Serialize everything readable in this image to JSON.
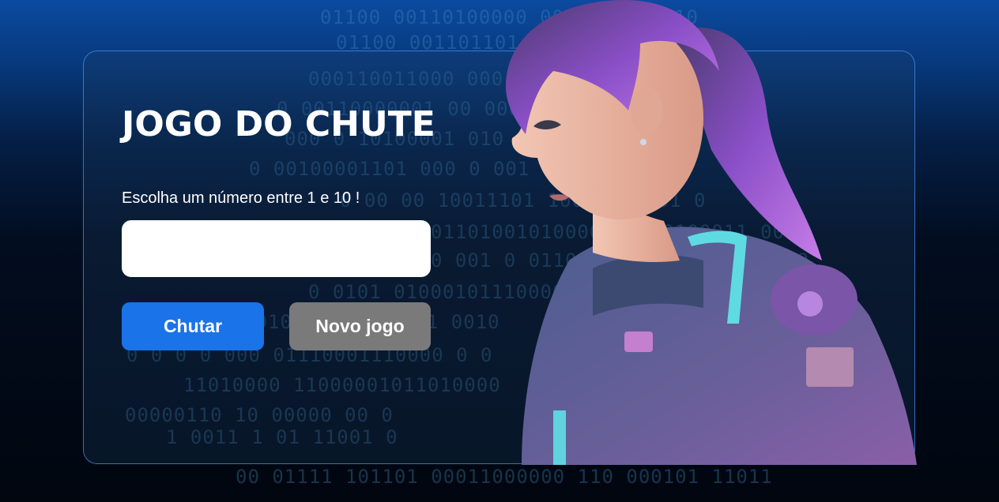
{
  "game": {
    "title": "JOGO DO CHUTE",
    "prompt": "Escolha um número entre 1 e 10 !",
    "input_value": "",
    "input_placeholder": "",
    "guess_button_label": "Chutar",
    "new_game_button_label": "Novo jogo"
  },
  "binary_lines": [
    "01100 00110100000        0001000000 10",
    "01100 001101101              011 1 0",
    "000110011000 000        0001101000010",
    "0  00110000001 00    0000011  0  0",
    "000 0  10100001 010         001011",
    "0  00100001101 000         0  001 0 0",
    "0 00 00 10011101 10001   11101  0",
    "01101001010000 000    0100011 00",
    "0 001 0 01100000110 1000000  0 0",
    "0 0101 010001011100000    000 01",
    "0 1 0 0 010 00001100001    0010",
    "0 0  0  0 000 01110001110000 0 0",
    "11010000 11000001011010000",
    "00000110  10  00000  00 0",
    "1  0011  1  01  11001 0",
    "00 01111  101101 00011000000 110 000101 11011"
  ],
  "illustration": {
    "description_icon": "astronaut-girl-illustration",
    "colors": {
      "hair": "#8a4fc7",
      "suit": "#5a6a9a",
      "glow": "#5ff0f0"
    }
  },
  "colors": {
    "primary_button": "#1a73e8",
    "secondary_button": "#7a7a7a",
    "card_border": "#468cf0"
  }
}
